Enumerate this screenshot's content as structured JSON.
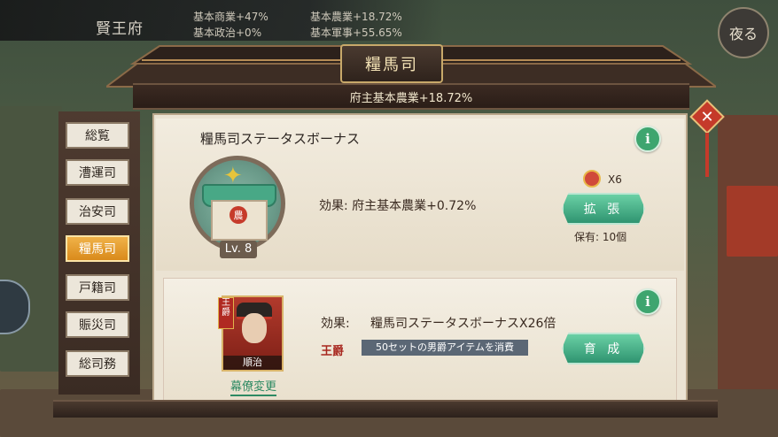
{
  "top": {
    "title": "賢王府",
    "stats": [
      "基本商業+47%",
      "基本農業+18.72%",
      "基本政治+0%",
      "基本軍事+55.65%"
    ]
  },
  "night_button": "夜る",
  "dialog": {
    "title": "糧馬司",
    "banner": "府主基本農業+18.72%"
  },
  "tabs": [
    {
      "label": "総覧",
      "active": false
    },
    {
      "label": "漕運司",
      "active": false
    },
    {
      "label": "治安司",
      "active": false
    },
    {
      "label": "糧馬司",
      "active": true
    },
    {
      "label": "戸籍司",
      "active": false
    },
    {
      "label": "賑災司",
      "active": false
    },
    {
      "label": "総司務",
      "active": false
    }
  ],
  "status_bonus": {
    "heading": "糧馬司ステータスボーナス",
    "level": "Lv. 8",
    "seal_char": "農",
    "effect": "効果: 府主基本農業+0.72%",
    "item_count": "X6",
    "expand_button": "拡 張",
    "owned": "保有: 10個"
  },
  "advisor": {
    "rank_badge": "王爵",
    "name": "順治",
    "change_link": "幕僚変更",
    "effect_label": "効果:",
    "effect_value": "糧馬司ステータスボーナスX26倍",
    "rank_label": "王爵",
    "requirement": "50セットの男爵アイテムを消費",
    "train_button": "育 成"
  },
  "info_icon": "i",
  "colors": {
    "accent_green": "#3ea56f",
    "active_tab": "#e39c2c",
    "close_red": "#c53a2a"
  }
}
